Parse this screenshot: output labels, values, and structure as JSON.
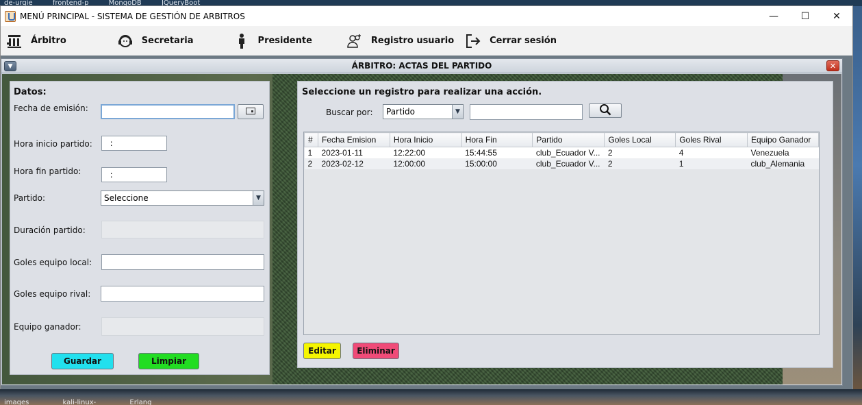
{
  "taskbar_top": [
    "de-urgie",
    "frontend-p",
    "MongoDB",
    "JQueryBoot"
  ],
  "taskbar_bottom": [
    "images",
    "kali-linux-",
    "Erlang"
  ],
  "window": {
    "title": "MENÚ PRINCIPAL - SISTEMA DE GESTIÓN DE ARBITROS",
    "minimize": "—",
    "maximize": "☐",
    "close": "✕"
  },
  "menu": {
    "items": [
      {
        "label": "Árbitro",
        "icon": "referee-icon"
      },
      {
        "label": "Secretaria",
        "icon": "headset-icon"
      },
      {
        "label": "Presidente",
        "icon": "person-icon"
      },
      {
        "label": "Registro usuario",
        "icon": "add-user-icon"
      },
      {
        "label": "Cerrar sesión",
        "icon": "logout-icon"
      }
    ]
  },
  "internal_frame": {
    "title": "ÁRBITRO: ACTAS DEL PARTIDO",
    "menu_button": "▼",
    "close_button": "✕"
  },
  "form": {
    "heading": "Datos:",
    "fecha_emision_label": "Fecha de emisión:",
    "fecha_emision_value": "",
    "hora_inicio_label": "Hora inicio partido:",
    "hora_inicio_value": "  :",
    "hora_fin_label": "Hora fin partido:",
    "hora_fin_value": "  :",
    "partido_label": "Partido:",
    "partido_selected": "Seleccione",
    "duracion_label": "Duración partido:",
    "duracion_value": "",
    "goles_local_label": "Goles equipo local:",
    "goles_local_value": "",
    "goles_rival_label": "Goles equipo rival:",
    "goles_rival_value": "",
    "equipo_ganador_label": "Equipo ganador:",
    "equipo_ganador_value": "",
    "guardar_label": "Guardar",
    "limpiar_label": "Limpiar",
    "guardar_color": "#22e0ee",
    "limpiar_color": "#22dd22"
  },
  "search": {
    "heading": "Seleccione un registro para realizar una acción.",
    "buscar_label": "Buscar por:",
    "buscar_selected": "Partido",
    "query": ""
  },
  "table": {
    "columns": [
      "#",
      "Fecha Emision",
      "Hora Inicio",
      "Hora Fin",
      "Partido",
      "Goles Local",
      "Goles Rival",
      "Equipo Ganador"
    ],
    "rows": [
      [
        "1",
        "2023-01-11",
        "12:22:00",
        "15:44:55",
        "club_Ecuador V...",
        "2",
        "4",
        "Venezuela"
      ],
      [
        "2",
        "2023-02-12",
        "12:00:00",
        "15:00:00",
        "club_Ecuador V...",
        "2",
        "1",
        "club_Alemania"
      ]
    ]
  },
  "actions": {
    "editar_label": "Editar",
    "eliminar_label": "Eliminar",
    "editar_color": "#f5f500",
    "eliminar_color": "#f04b78"
  }
}
